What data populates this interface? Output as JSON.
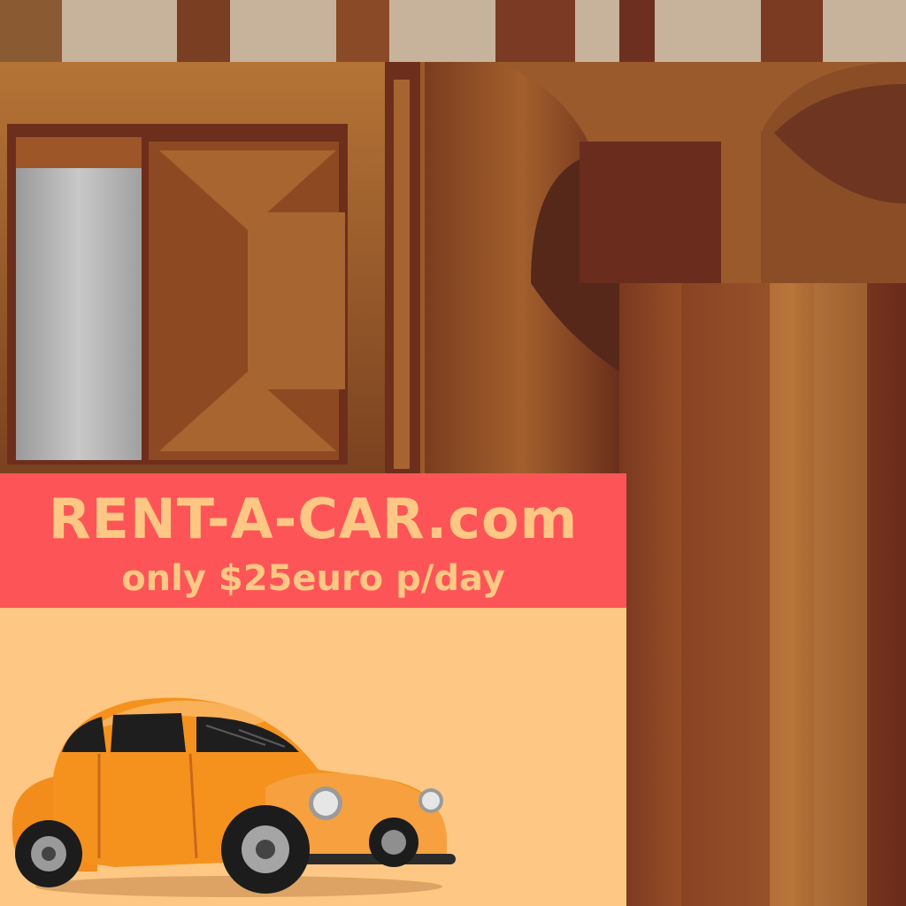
{
  "ad": {
    "headline": "RENT-A-CAR.com",
    "tagline": "only $25euro p/day"
  },
  "colors": {
    "banner": "#fd5557",
    "banner_text": "#fec783",
    "poster_background": "#fec783",
    "car_body": "#f5921e",
    "wood_light": "#a86a35",
    "wood_dark": "#6d2f1c"
  },
  "icons": {
    "car": "orange-beetle-car"
  }
}
